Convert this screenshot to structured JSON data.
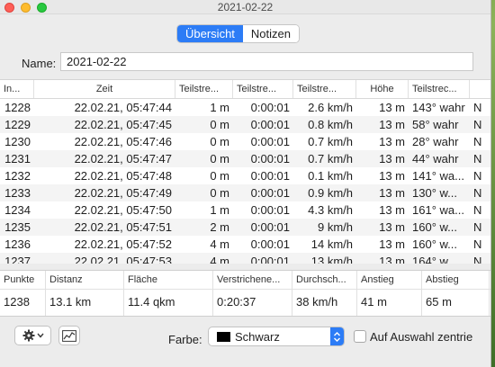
{
  "window": {
    "title": "2021-02-22"
  },
  "tabs": [
    {
      "label": "Übersicht",
      "active": true
    },
    {
      "label": "Notizen",
      "active": false
    }
  ],
  "name_field": {
    "label": "Name:",
    "value": "2021-02-22"
  },
  "table": {
    "columns": [
      "In...",
      "Zeit",
      "Teilstre...",
      "Teilstre...",
      "Teilstre...",
      "Höhe",
      "Teilstrec..."
    ],
    "rows": [
      [
        "1228",
        "22.02.21, 05:47:44",
        "1 m",
        "0:00:01",
        "2.6 km/h",
        "13 m",
        "143° wahr",
        "N"
      ],
      [
        "1229",
        "22.02.21, 05:47:45",
        "0 m",
        "0:00:01",
        "0.8 km/h",
        "13 m",
        "58° wahr",
        "N"
      ],
      [
        "1230",
        "22.02.21, 05:47:46",
        "0 m",
        "0:00:01",
        "0.7 km/h",
        "13 m",
        "28° wahr",
        "N"
      ],
      [
        "1231",
        "22.02.21, 05:47:47",
        "0 m",
        "0:00:01",
        "0.7 km/h",
        "13 m",
        "44° wahr",
        "N"
      ],
      [
        "1232",
        "22.02.21, 05:47:48",
        "0 m",
        "0:00:01",
        "0.1 km/h",
        "13 m",
        "141° wa...",
        "N"
      ],
      [
        "1233",
        "22.02.21, 05:47:49",
        "0 m",
        "0:00:01",
        "0.9 km/h",
        "13 m",
        "130° w...",
        "N"
      ],
      [
        "1234",
        "22.02.21, 05:47:50",
        "1 m",
        "0:00:01",
        "4.3 km/h",
        "13 m",
        "161° wa...",
        "N"
      ],
      [
        "1235",
        "22.02.21, 05:47:51",
        "2 m",
        "0:00:01",
        "9 km/h",
        "13 m",
        "160° w...",
        "N"
      ],
      [
        "1236",
        "22.02.21, 05:47:52",
        "4 m",
        "0:00:01",
        "14 km/h",
        "13 m",
        "160° w...",
        "N"
      ],
      [
        "1237",
        "22.02.21, 05:47:53",
        "4 m",
        "0:00:01",
        "13 km/h",
        "13 m",
        "164° w...",
        "N"
      ]
    ]
  },
  "stats": {
    "headers": [
      "Punkte",
      "Distanz",
      "Fläche",
      "Verstrichene...",
      "Durchsch...",
      "Anstieg",
      "Abstieg"
    ],
    "values": [
      "1238",
      "13.1 km",
      "11.4 qkm",
      "0:20:37",
      "38 km/h",
      "41 m",
      "65 m"
    ]
  },
  "footer": {
    "color_label": "Farbe:",
    "color_value": "Schwarz",
    "color_swatch": "#000000",
    "checkbox_label": "Auf Auswahl zentrie",
    "gear_icon": "gear-icon",
    "chart_icon": "line-chart-icon"
  },
  "colors": {
    "accent": "#2c7cf6"
  }
}
